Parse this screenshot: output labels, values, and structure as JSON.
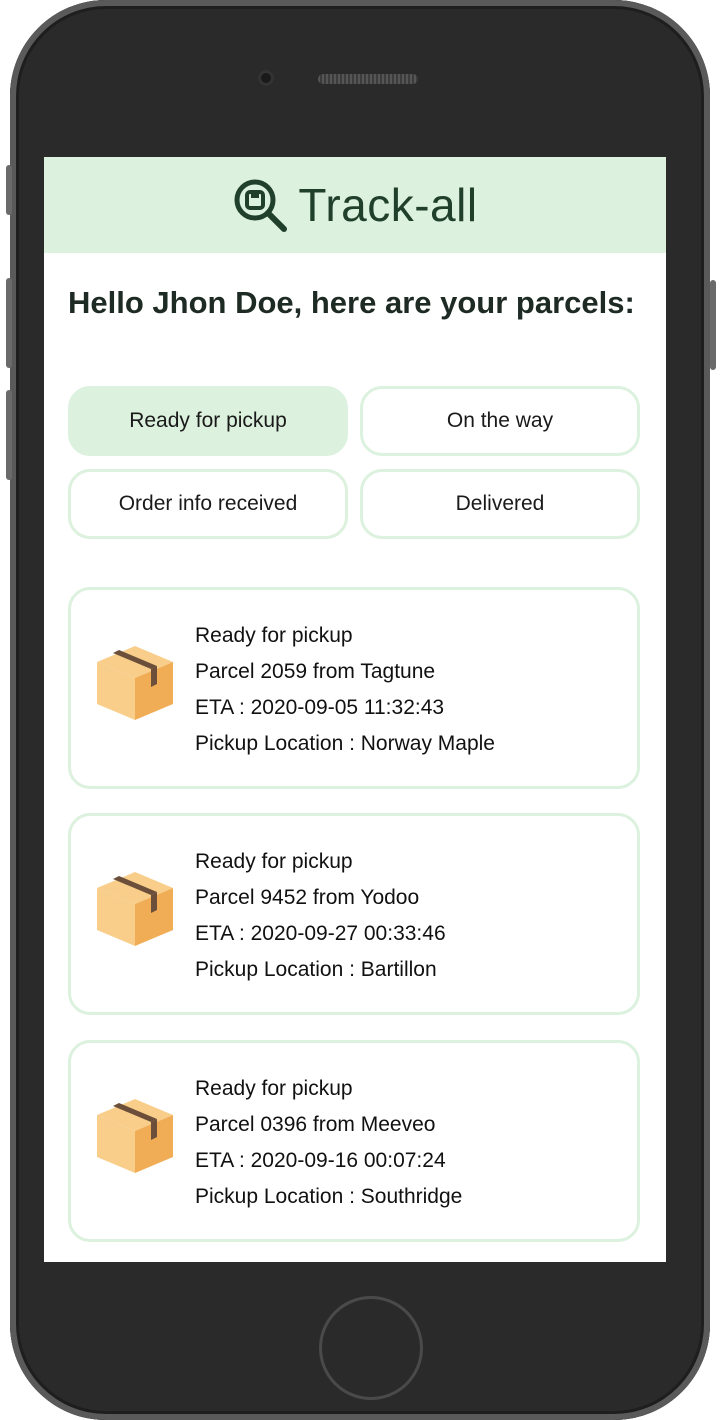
{
  "app": {
    "title": "Track-all"
  },
  "greeting": "Hello Jhon Doe, here are your parcels:",
  "filters": [
    {
      "label": "Ready for pickup",
      "active": true
    },
    {
      "label": "On the way",
      "active": false
    },
    {
      "label": "Order info received",
      "active": false
    },
    {
      "label": "Delivered",
      "active": false
    }
  ],
  "parcels": [
    {
      "status": "Ready for pickup",
      "title": "Parcel 2059 from Tagtune",
      "eta": "ETA : 2020-09-05 11:32:43",
      "location": "Pickup Location : Norway Maple"
    },
    {
      "status": "Ready for pickup",
      "title": "Parcel 9452 from Yodoo",
      "eta": "ETA : 2020-09-27 00:33:46",
      "location": "Pickup Location : Bartillon"
    },
    {
      "status": "Ready for pickup",
      "title": "Parcel 0396 from Meeveo",
      "eta": "ETA : 2020-09-16 00:07:24",
      "location": "Pickup Location : Southridge"
    }
  ],
  "icons": {
    "logo": "magnifier-parcel-icon",
    "parcel": "cardboard-box-icon"
  },
  "colors": {
    "accent": "#dcf1de",
    "brand_text": "#20402c",
    "box_light": "#f8ce8a",
    "box_dark": "#f0ad55",
    "tape": "#6b4f3a"
  }
}
